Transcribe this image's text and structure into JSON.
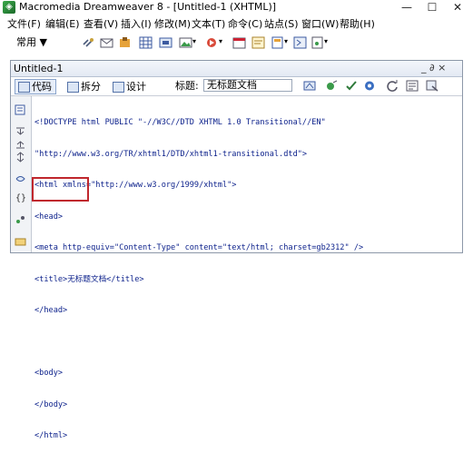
{
  "window": {
    "title": "Macromedia Dreamweaver 8 - [Untitled-1 (XHTML)]",
    "app_icon_glyph": "◈",
    "minimize_glyph": "—",
    "restore_glyph": "☐",
    "close_glyph": "✕"
  },
  "menu": {
    "items": [
      "文件(F)",
      "编辑(E)",
      "查看(V)",
      "插入(I)",
      "修改(M)",
      "文本(T)",
      "命令(C)",
      "站点(S)",
      "窗口(W)",
      "帮助(H)"
    ]
  },
  "insert_bar": {
    "category_label": "常用 ▼",
    "icons": [
      "hyperlink-icon",
      "email-icon",
      "anchor-icon",
      "table-icon",
      "layer-icon",
      "image-icon",
      "media-icon",
      "date-icon",
      "comment-icon",
      "template-icon",
      "tag-chooser-icon"
    ]
  },
  "document": {
    "tab_label": "Untitled-1",
    "window_controls": "_ ∂ ×",
    "views": {
      "code": "代码",
      "split": "拆分",
      "design": "设计"
    },
    "title_label": "标题:",
    "title_value": "无标题文档"
  },
  "code_lines": [
    "<!DOCTYPE html PUBLIC \"-//W3C//DTD XHTML 1.0 Transitional//EN\"",
    "\"http://www.w3.org/TR/xhtml1/DTD/xhtml1-transitional.dtd\">",
    "<html xmlns=\"http://www.w3.org/1999/xhtml\">",
    "<head>",
    "<meta http-equiv=\"Content-Type\" content=\"text/html; charset=gb2312\" />",
    "<title>无标题文档</title>",
    "</head>",
    "",
    "<body>",
    "</body>",
    "</html>"
  ],
  "colors": {
    "code_text": "#0a1f8a",
    "highlight_border": "#c0272d"
  }
}
